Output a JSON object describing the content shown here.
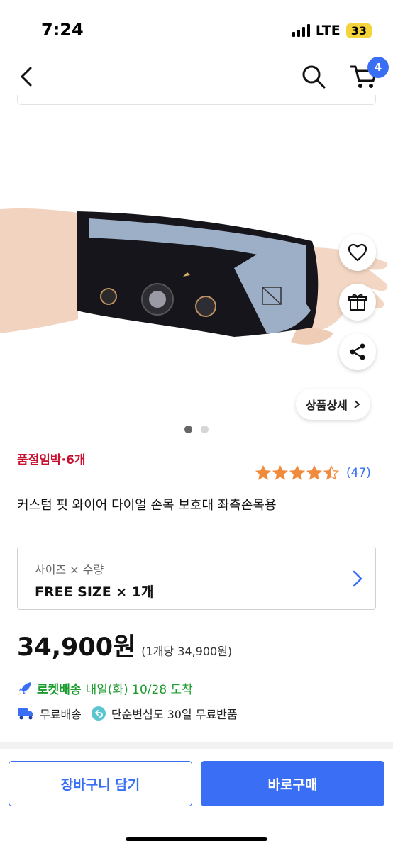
{
  "status_bar": {
    "time": "7:24",
    "network": "LTE",
    "battery": "33"
  },
  "nav": {
    "cart_count": "4"
  },
  "product": {
    "stock_warning": "품절임박·6개",
    "rating_value": 4.5,
    "review_count": "(47)",
    "title": "커스텀 핏 와이어 다이얼 손목 보호대 좌측손목용",
    "detail_button": "상품상세",
    "image_total": 2,
    "image_active": 1
  },
  "option": {
    "label": "사이즈 × 수량",
    "value": "FREE SIZE × 1개"
  },
  "price": {
    "amount": "34,900원",
    "unit_price": "(1개당 34,900원)"
  },
  "delivery": {
    "rocket_label": "로켓배송",
    "arrival": "내일(화) 10/28 도착",
    "free_shipping": "무료배송",
    "free_return": "단순변심도 30일 무료반품"
  },
  "actions": {
    "add_to_cart": "장바구니 담기",
    "buy_now": "바로구매"
  },
  "colors": {
    "accent": "#3a6ff5",
    "warning": "#c8102e",
    "rocket_green": "#1c9b2e",
    "star": "#f08a3c"
  }
}
